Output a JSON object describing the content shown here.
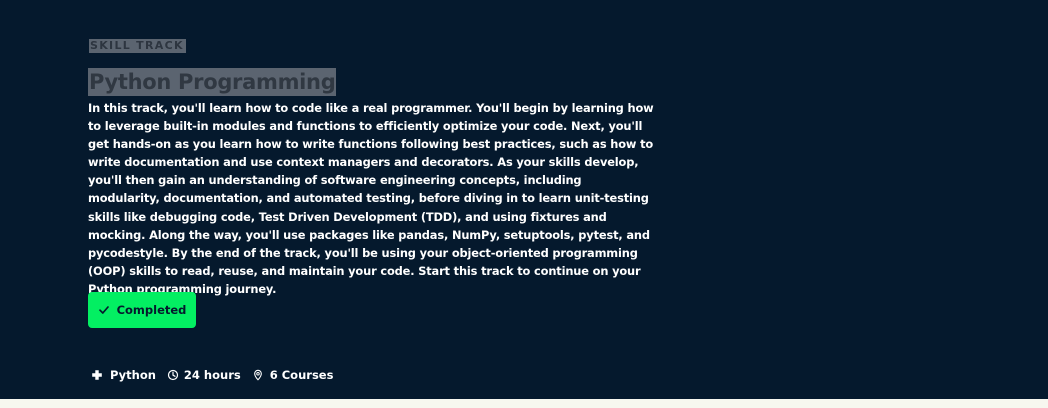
{
  "track": {
    "eyebrow": "SKILL TRACK",
    "title": "Python Programming",
    "description": "In this track, you'll learn how to code like a real programmer. You'll begin by learning how to leverage built-in modules and functions to efficiently optimize your code. Next, you'll get hands-on as you learn how to write functions following best practices, such as how to write documentation and use context managers and decorators. As your skills develop, you'll then gain an understanding of software engineering concepts, including modularity, documentation, and automated testing, before diving in to learn unit-testing skills like debugging code, Test Driven Development (TDD), and using fixtures and mocking. Along the way, you'll use packages like pandas, NumPy, setuptools, pytest, and pycodestyle. By the end of the track, you'll be using your object-oriented programming (OOP) skills to read, reuse, and maintain your code. Start this track to continue on your Python programming journey.",
    "status_button_label": "Completed"
  },
  "meta": {
    "technology": "Python",
    "duration": "24 hours",
    "courses": "6 Courses",
    "technology_icon": "plus-icon",
    "duration_icon": "clock-icon",
    "courses_icon": "location-pin-icon"
  },
  "colors": {
    "hero_background": "#05192d",
    "accent": "#03ef62",
    "page_background": "#f7f7ef"
  }
}
